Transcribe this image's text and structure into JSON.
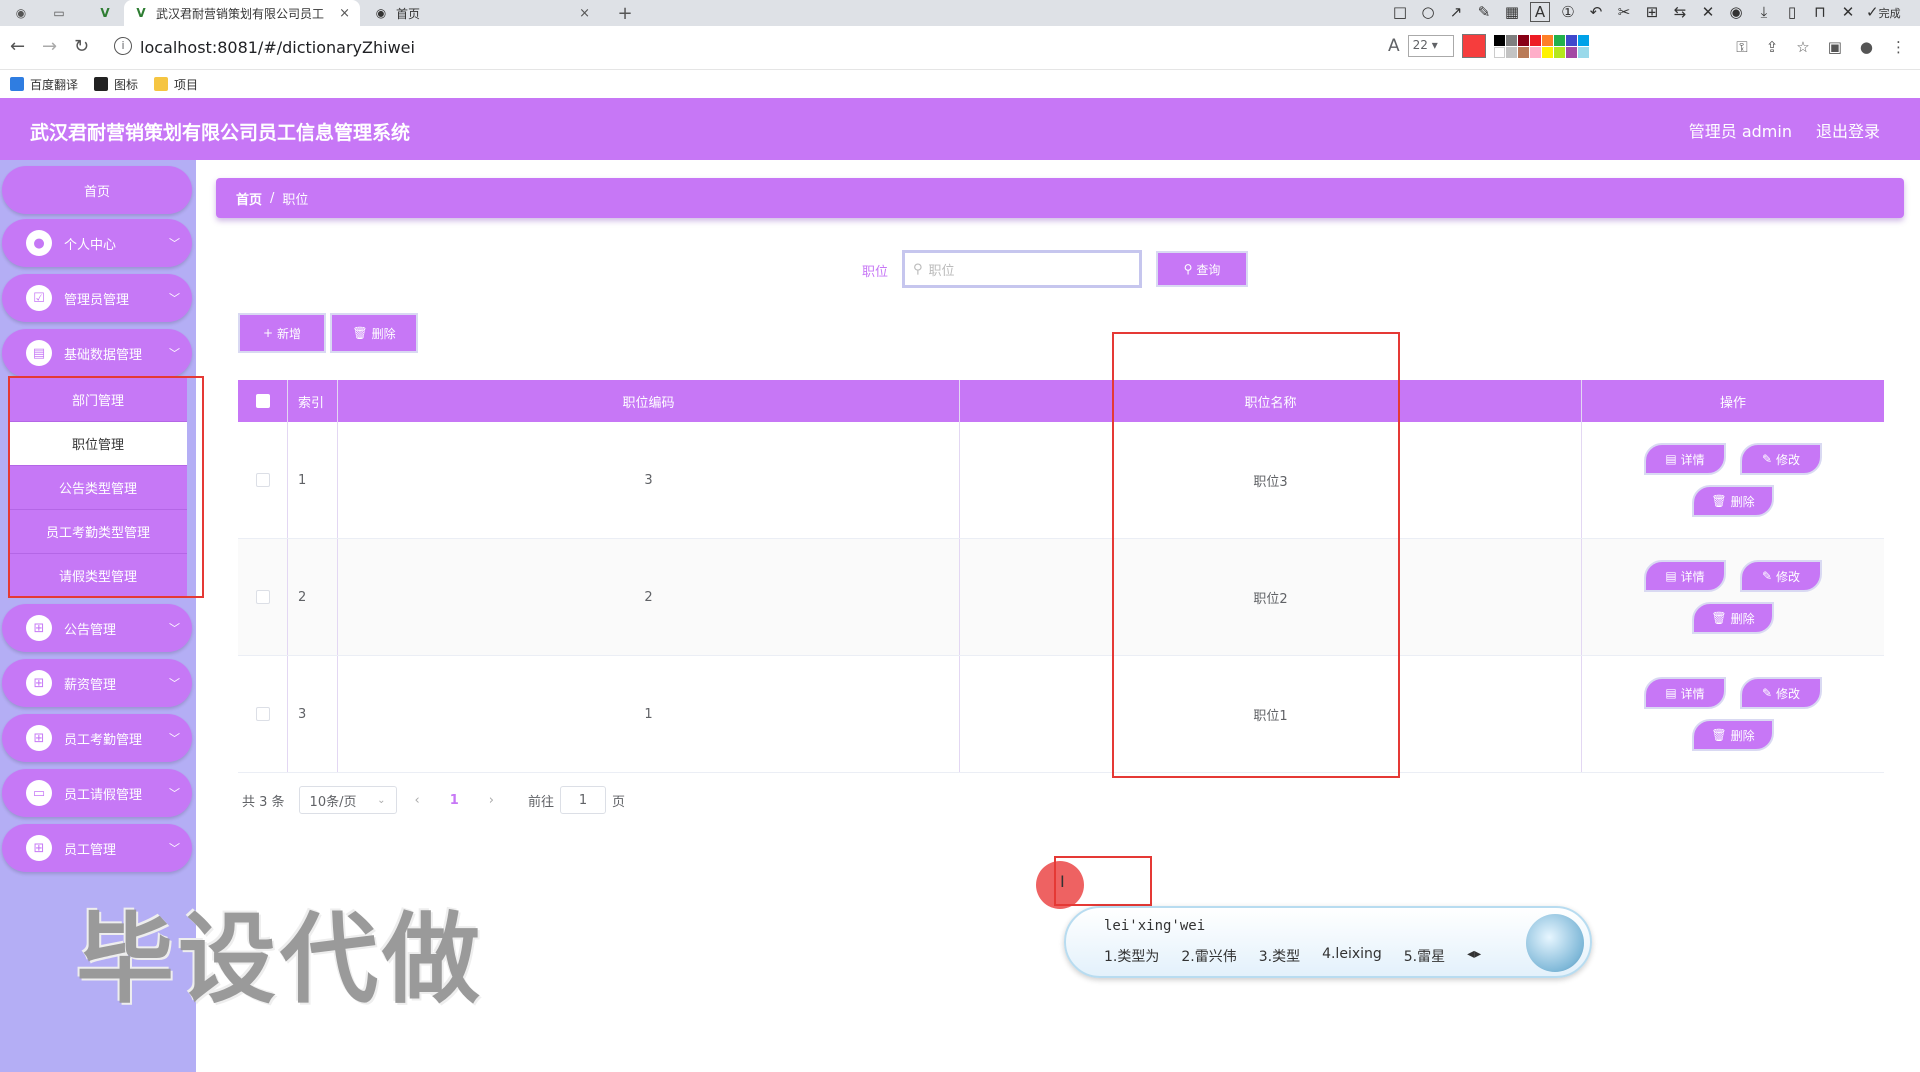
{
  "browser": {
    "tabs": [
      {
        "title": "武汉君耐营销策划有限公司员工",
        "active": true
      },
      {
        "title": "首页",
        "active": false
      }
    ],
    "url": "localhost:8081/#/dictionaryZhiwei",
    "font_size_value": "22",
    "done_label": "完成",
    "bookmarks": [
      "百度翻译",
      "图标",
      "项目"
    ]
  },
  "app": {
    "title": "武汉君耐营销策划有限公司员工信息管理系统",
    "user_label": "管理员 admin",
    "logout_label": "退出登录"
  },
  "sidebar": {
    "home": "首页",
    "menus": [
      {
        "label": "个人中心"
      },
      {
        "label": "管理员管理"
      },
      {
        "label": "基础数据管理"
      },
      {
        "label": "公告管理"
      },
      {
        "label": "薪资管理"
      },
      {
        "label": "员工考勤管理"
      },
      {
        "label": "员工请假管理"
      },
      {
        "label": "员工管理"
      }
    ],
    "submenus": [
      {
        "label": "部门管理"
      },
      {
        "label": "职位管理"
      },
      {
        "label": "公告类型管理"
      },
      {
        "label": "员工考勤类型管理"
      },
      {
        "label": "请假类型管理"
      }
    ]
  },
  "breadcrumb": {
    "home": "首页",
    "sep": "/",
    "current": "职位"
  },
  "search": {
    "label": "职位",
    "placeholder": "职位",
    "button": "查询"
  },
  "toolbar": {
    "add": "新增",
    "delete": "删除"
  },
  "table": {
    "headers": {
      "index": "索引",
      "code": "职位编码",
      "name": "职位名称",
      "ops": "操作"
    },
    "rows": [
      {
        "index": "1",
        "code": "3",
        "name": "职位3"
      },
      {
        "index": "2",
        "code": "2",
        "name": "职位2"
      },
      {
        "index": "3",
        "code": "1",
        "name": "职位1"
      }
    ],
    "op_labels": {
      "detail": "详情",
      "edit": "修改",
      "delete": "删除"
    }
  },
  "pagination": {
    "total": "共 3 条",
    "page_size": "10条/页",
    "current_page": "1",
    "goto_label": "前往",
    "goto_value": "1",
    "page_suffix": "页"
  },
  "ime": {
    "composition": "lei'xing'wei",
    "candidates": [
      "1.类型为",
      "2.雷兴伟",
      "3.类型",
      "4.leixing",
      "5.雷星"
    ]
  },
  "watermark": "毕设代做",
  "colors": {
    "accent": "#c777f6",
    "sidebar_bg": "#b4aef5",
    "highlight_box": "#e53935"
  }
}
